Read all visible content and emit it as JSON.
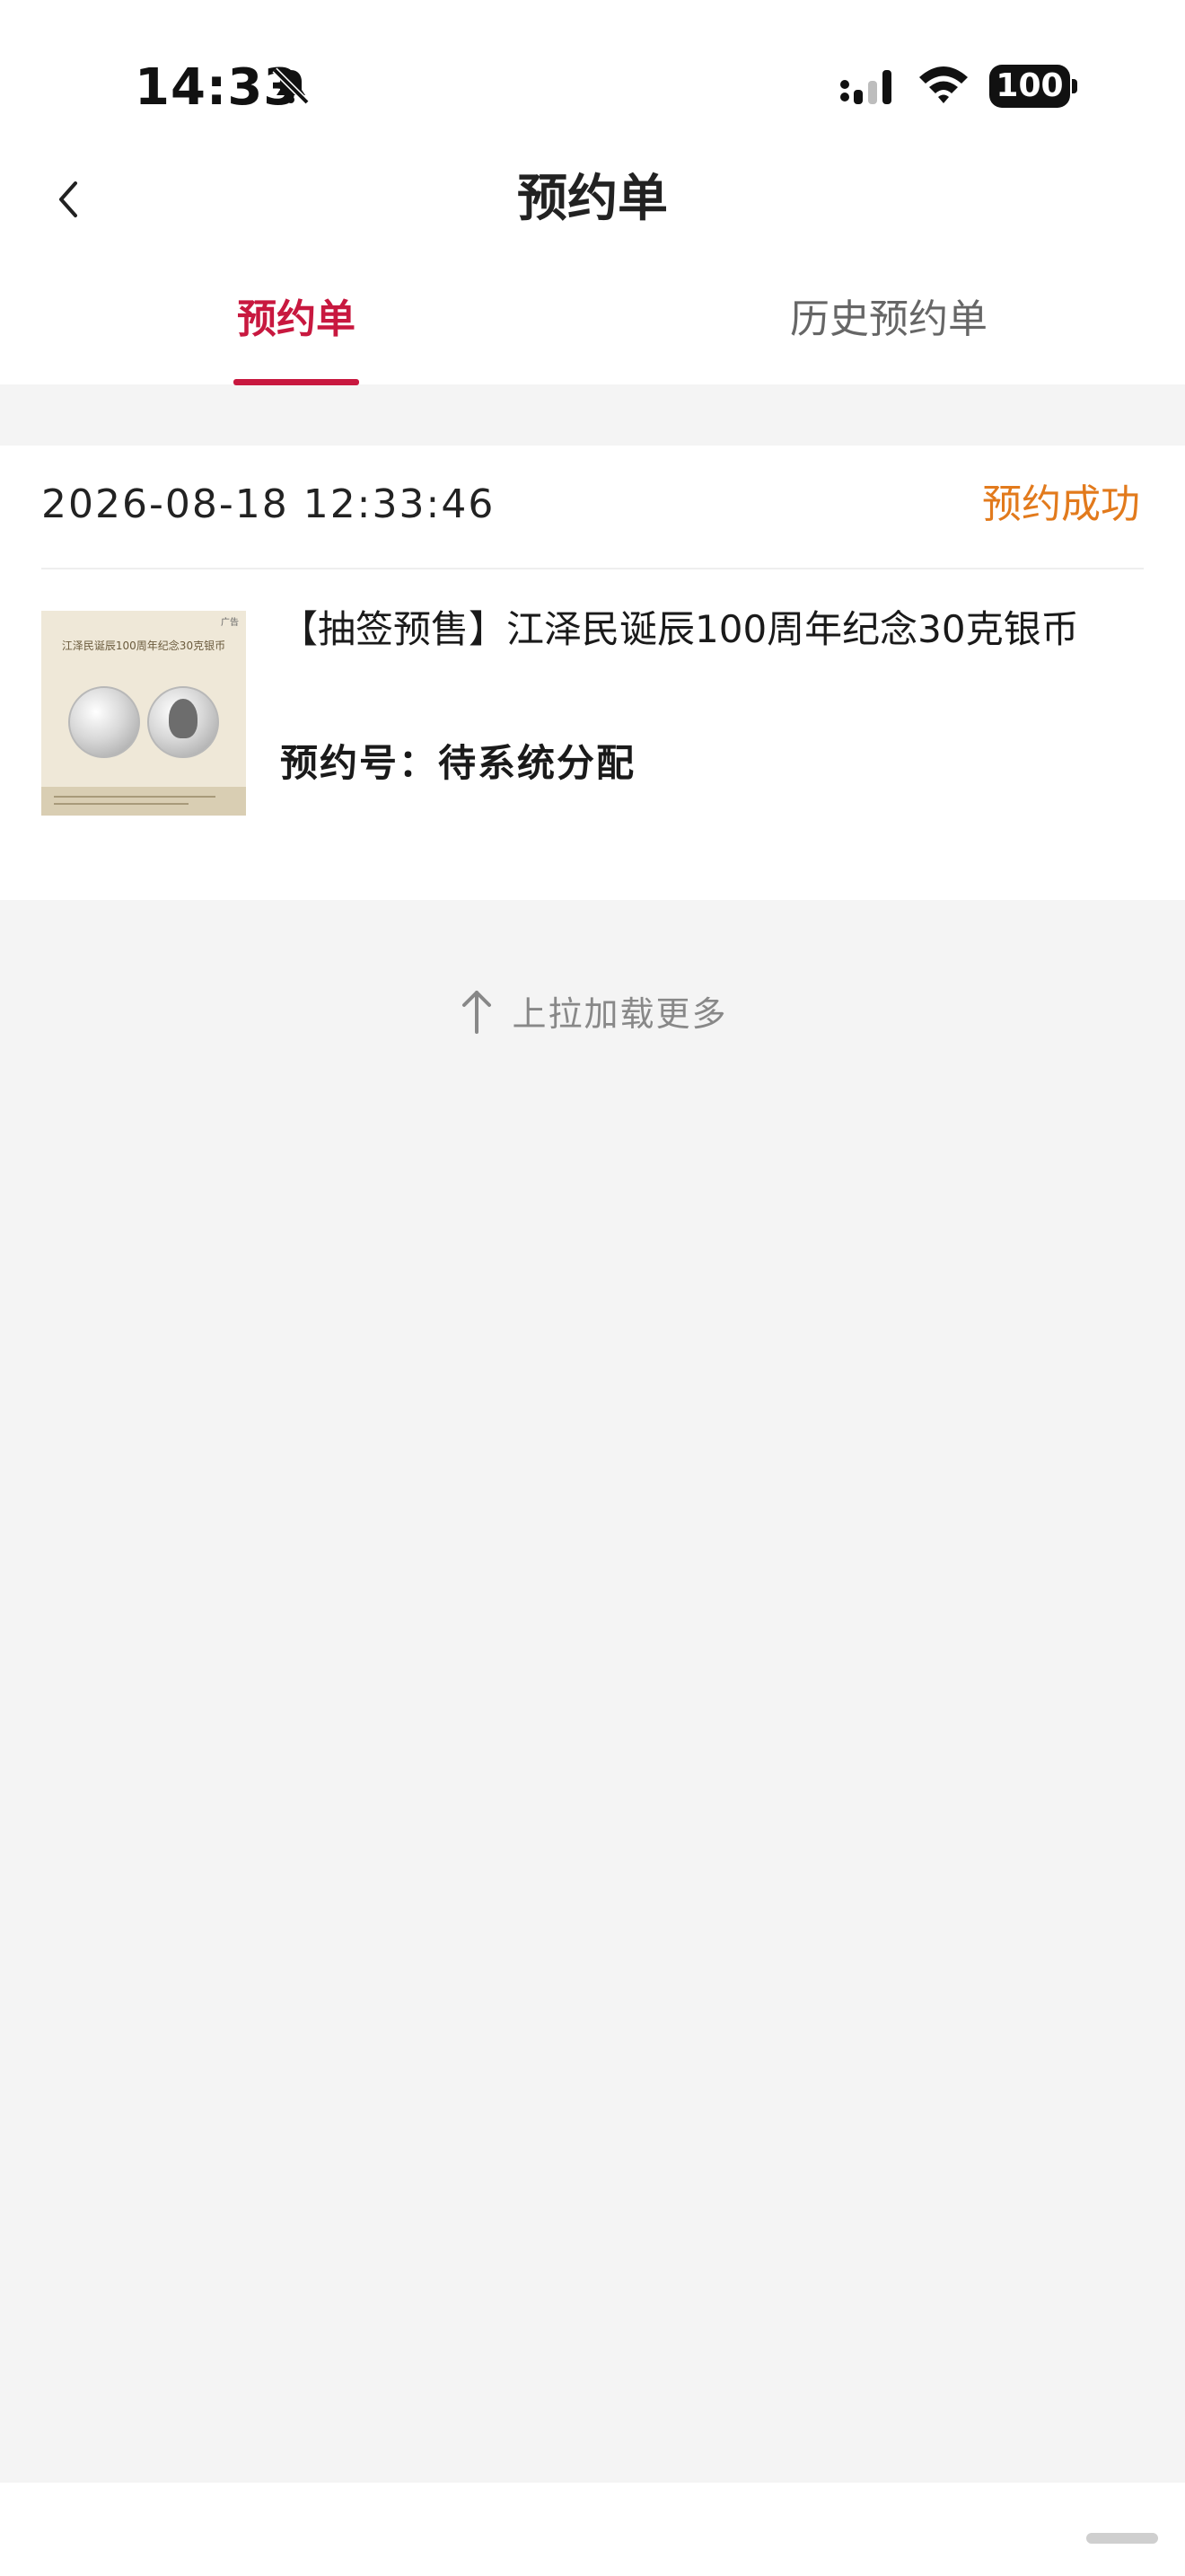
{
  "status_bar": {
    "time": "14:33",
    "battery": "100",
    "icons": [
      "bell-slash-icon",
      "signal-icon",
      "wifi-icon",
      "battery-icon"
    ]
  },
  "nav": {
    "title": "预约单",
    "back_icon": "chevron-left-icon"
  },
  "tabs": [
    {
      "label": "预约单",
      "active": true
    },
    {
      "label": "历史预约单",
      "active": false
    }
  ],
  "reservation": {
    "datetime": "2026-08-18 12:33:46",
    "status": "预约成功",
    "product_title": "【抽签预售】江泽民诞辰100周年纪念30克银币",
    "reservation_label": "预约号：",
    "reservation_value": "待系统分配",
    "thumbnail": {
      "ad_label": "广告",
      "caption": "江泽民诞辰100周年纪念30克银币"
    }
  },
  "load_more": {
    "text": "上拉加载更多",
    "icon": "arrow-up-icon"
  },
  "colors": {
    "accent": "#c8183f",
    "status_success": "#e27a1c",
    "background": "#f4f4f4"
  }
}
